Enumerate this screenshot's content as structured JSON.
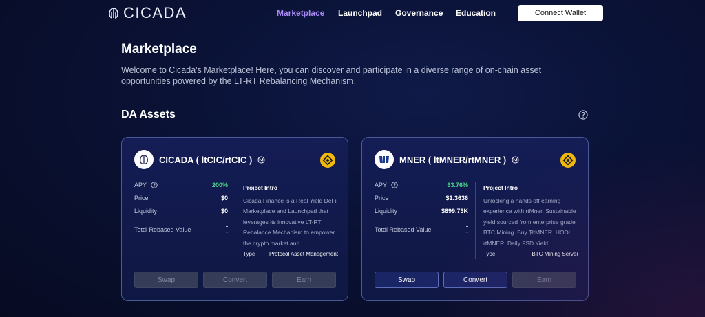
{
  "header": {
    "brand": "CICADA",
    "nav": [
      "Marketplace",
      "Launchpad",
      "Governance",
      "Education"
    ],
    "active_nav": "Marketplace",
    "connect_label": "Connect Wallet"
  },
  "main": {
    "title": "Marketplace",
    "intro": "Welcome to Cicada's Marketplace! Here, you can discover and participate in a diverse range of on-chain asset opportunities powered by the LT-RT Rebalancing Mechanism.",
    "section_title": "DA Assets"
  },
  "cards": [
    {
      "title": "CICADA ( ltCIC/rtCIC )",
      "stats": {
        "apy_label": "APY",
        "apy": "200%",
        "price_label": "Price",
        "price": "$0",
        "liquidity_label": "Liquidity",
        "liquidity": "$0",
        "rebased_label": "Totdl Rebased Value",
        "rebased": "-",
        "rebased_sub": "-"
      },
      "intro_heading": "Project Intro",
      "intro_text": "Cicada Finance is a Real Yield DeFi Marketplace and Launchpad that leverages its innovative LT-RT Rebalance Mechanism to empower the crypto market and...",
      "type_label": "Type",
      "type_value": "Protocol Asset Management",
      "buttons": [
        "Swap",
        "Convert",
        "Earn"
      ]
    },
    {
      "title": "MNER ( ltMNER/rtMNER )",
      "stats": {
        "apy_label": "APY",
        "apy": "63.76%",
        "price_label": "Price",
        "price": "$1.3636",
        "liquidity_label": "Liquidity",
        "liquidity": "$699.73K",
        "rebased_label": "Totdl Rebased Value",
        "rebased": "-",
        "rebased_sub": "-"
      },
      "intro_heading": "Project Intro",
      "intro_text": "Unlocking a hands off earning experience with rtMner. Sustainable yield sourced from enterprise grade BTC Mining. Buy $ltMNER. HODL rtMNER. Daily FSD Yield.",
      "type_label": "Type",
      "type_value": "BTC Mining Server",
      "buttons": [
        "Swap",
        "Convert",
        "Earn"
      ]
    }
  ],
  "colors": {
    "accent": "#a889f5",
    "apy_green": "#4cd68a",
    "bnb_yellow": "#f0b90b"
  }
}
